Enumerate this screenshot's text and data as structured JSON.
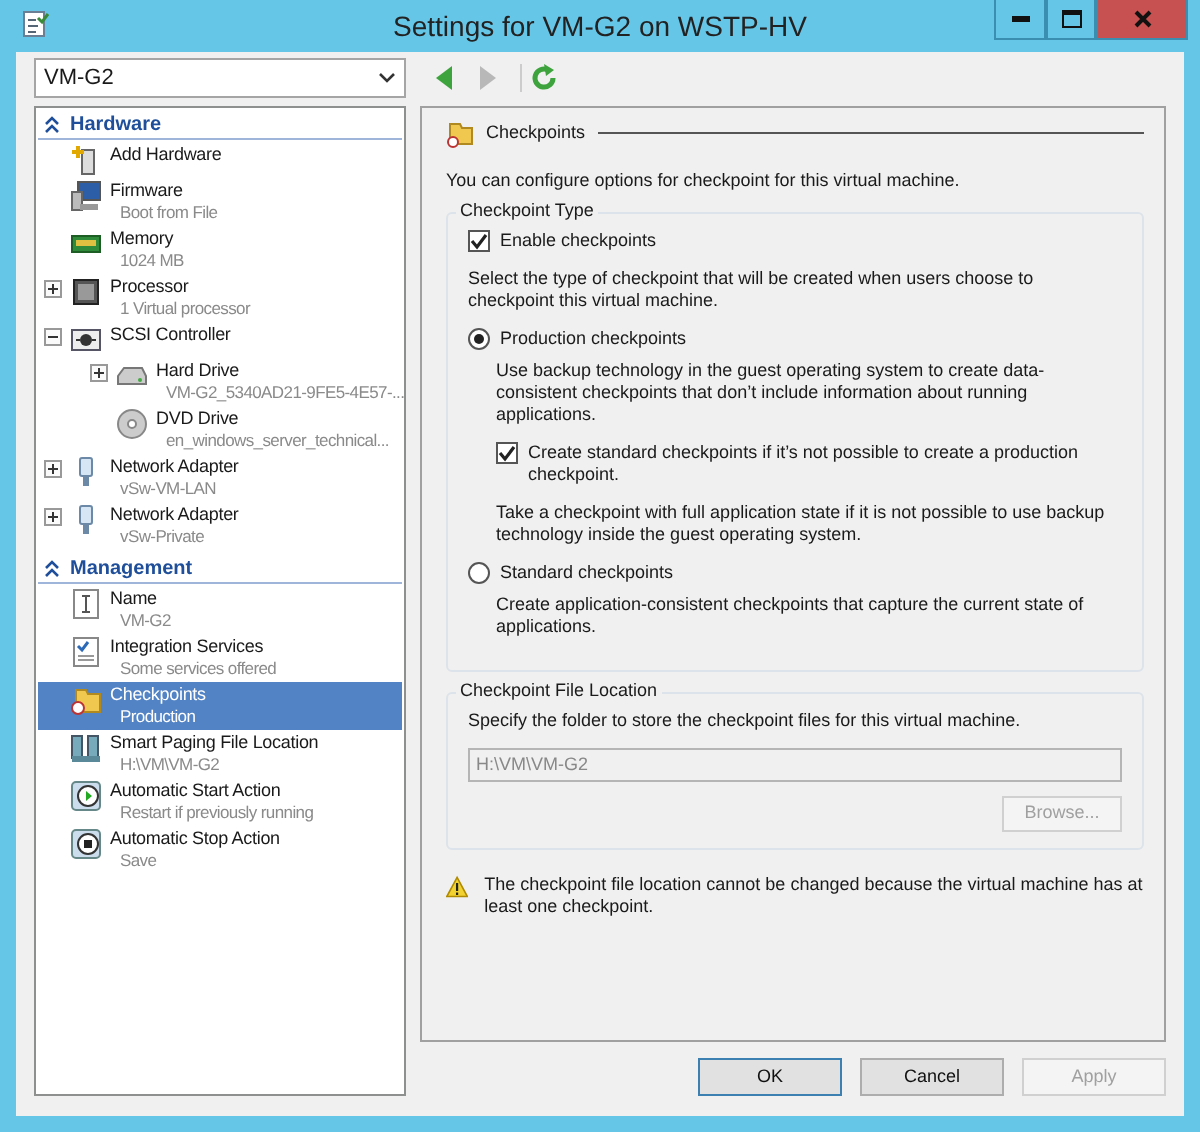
{
  "window": {
    "title": "Settings for VM-G2 on WSTP-HV"
  },
  "vm_selector": {
    "value": "VM-G2"
  },
  "toolbar": [
    {
      "kind": "back",
      "disabled": false
    },
    {
      "kind": "forward",
      "disabled": true
    },
    {
      "kind": "refresh",
      "disabled": false
    }
  ],
  "sidebar": {
    "sections": [
      {
        "title": "Hardware",
        "items": [
          {
            "kind": "add-hardware",
            "label": "Add Hardware",
            "selected": false
          },
          {
            "kind": "firmware",
            "label": "Firmware",
            "detail": "Boot from File",
            "selected": false
          },
          {
            "kind": "memory",
            "label": "Memory",
            "detail": "1024 MB",
            "selected": false
          },
          {
            "kind": "processor",
            "label": "Processor",
            "detail": "1 Virtual processor",
            "expanded": false,
            "selected": false
          },
          {
            "kind": "scsi",
            "label": "SCSI Controller",
            "expanded": true,
            "selected": false,
            "children": [
              {
                "kind": "hard-drive",
                "label": "Hard Drive",
                "detail": "VM-G2_5340AD21-9FE5-4E57-...",
                "expanded": false,
                "selected": false
              },
              {
                "kind": "dvd",
                "label": "DVD Drive",
                "detail": "en_windows_server_technical...",
                "selected": false
              }
            ]
          },
          {
            "kind": "network",
            "label": "Network Adapter",
            "detail": "vSw-VM-LAN",
            "expanded": false,
            "selected": false
          },
          {
            "kind": "network",
            "label": "Network Adapter",
            "detail": "vSw-Private",
            "expanded": false,
            "selected": false
          }
        ]
      },
      {
        "title": "Management",
        "items": [
          {
            "kind": "name",
            "label": "Name",
            "detail": "VM-G2",
            "selected": false
          },
          {
            "kind": "integration",
            "label": "Integration Services",
            "detail": "Some services offered",
            "selected": false
          },
          {
            "kind": "checkpoints",
            "label": "Checkpoints",
            "detail": "Production",
            "selected": true
          },
          {
            "kind": "paging",
            "label": "Smart Paging File Location",
            "detail": "H:\\VM\\VM-G2",
            "selected": false
          },
          {
            "kind": "start",
            "label": "Automatic Start Action",
            "detail": "Restart if previously running",
            "selected": false
          },
          {
            "kind": "stop",
            "label": "Automatic Stop Action",
            "detail": "Save",
            "selected": false
          }
        ]
      }
    ]
  },
  "panel": {
    "title": "Checkpoints",
    "intro": "You can configure options for checkpoint for this virtual machine.",
    "groups": [
      {
        "title": "Checkpoint Type",
        "options": [
          {
            "kind": "checkbox",
            "label": "Enable checkpoints",
            "checked": true
          },
          {
            "kind": "note",
            "text": "Select the type of checkpoint that will be created when users choose to checkpoint this virtual machine."
          },
          {
            "kind": "radio",
            "label": "Production checkpoints",
            "selected": true,
            "children": [
              {
                "kind": "note",
                "text": "Use backup technology in the guest operating system to create data-consistent checkpoints that don’t include information about running applications."
              },
              {
                "kind": "checkbox",
                "label": "Create standard checkpoints if it’s not possible to create a production checkpoint.",
                "checked": true
              },
              {
                "kind": "note",
                "text": "Take a checkpoint with full application state if it is not possible to use backup technology inside the guest operating system."
              }
            ]
          },
          {
            "kind": "radio",
            "label": "Standard checkpoints",
            "selected": false,
            "children": [
              {
                "kind": "note",
                "text": "Create application-consistent checkpoints that capture the current state of applications."
              }
            ]
          }
        ]
      },
      {
        "title": "Checkpoint File Location",
        "options": [
          {
            "kind": "note",
            "text": "Specify the folder to store the checkpoint files for this virtual machine."
          },
          {
            "kind": "field",
            "value": "H:\\VM\\VM-G2",
            "disabled": true
          },
          {
            "kind": "button",
            "label": "Browse...",
            "disabled": true
          }
        ]
      }
    ],
    "warning": "The checkpoint file location cannot be changed because the virtual machine has at least one checkpoint."
  },
  "buttons": [
    {
      "label": "OK",
      "default": true,
      "disabled": false
    },
    {
      "label": "Cancel",
      "default": false,
      "disabled": false
    },
    {
      "label": "Apply",
      "default": false,
      "disabled": true
    }
  ]
}
